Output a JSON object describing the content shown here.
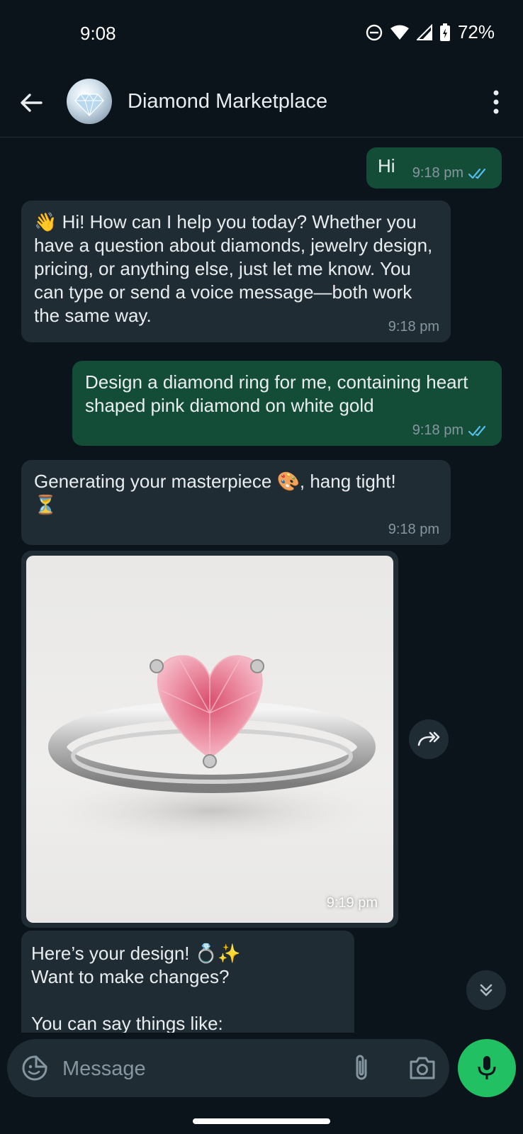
{
  "status_bar": {
    "time": "9:08",
    "battery": "72%"
  },
  "header": {
    "title": "Diamond Marketplace"
  },
  "messages": [
    {
      "direction": "out",
      "text": "Hi",
      "time": "9:18 pm",
      "read": true
    },
    {
      "direction": "in",
      "emoji": "👋",
      "text": "Hi! How can I help you today? Whether you have a question about diamonds, jewelry design, pricing, or anything else, just let me know. You can type or send a voice message—both work the same way.",
      "time": "9:18 pm"
    },
    {
      "direction": "out",
      "text": "Design a diamond ring for me, containing heart shaped pink diamond on white gold",
      "time": "9:18 pm",
      "read": true
    },
    {
      "direction": "in",
      "text": "Generating your masterpiece 🎨, hang tight!\n⏳",
      "time": "9:18 pm"
    },
    {
      "direction": "in",
      "type": "image",
      "image_subject": "white gold ring with heart shaped pink diamond",
      "time": "9:19 pm"
    },
    {
      "direction": "in",
      "text": "Here’s your design! 💍✨\nWant to make changes?\n\nYou can say things like:"
    }
  ],
  "composer": {
    "placeholder": "Message"
  },
  "colors": {
    "outgoing": "#144d37",
    "incoming": "#1f2c34",
    "background": "#0b141a",
    "accent": "#21c063",
    "read_ticks": "#53bdeb"
  }
}
